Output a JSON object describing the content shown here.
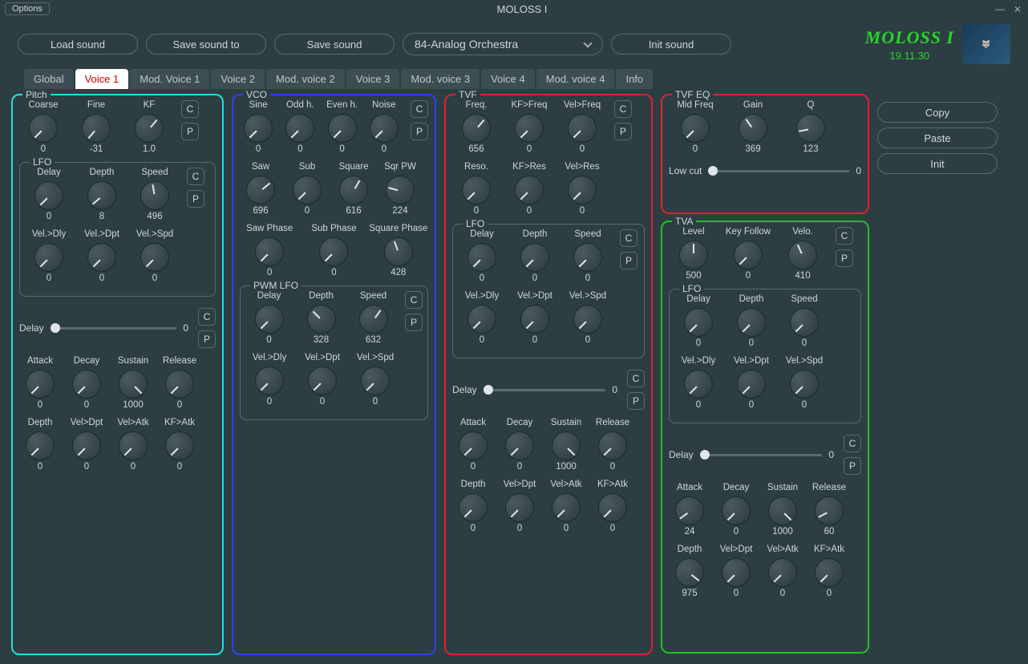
{
  "window": {
    "options": "Options",
    "title": "MOLOSS I"
  },
  "brand": {
    "name": "MOLOSS I",
    "version": "19.11.30"
  },
  "toolbar": {
    "load": "Load sound",
    "saveTo": "Save sound to",
    "save": "Save sound",
    "preset": "84-Analog Orchestra",
    "init": "Init sound"
  },
  "side": {
    "copy": "Copy",
    "paste": "Paste",
    "init": "Init"
  },
  "cp": {
    "c": "C",
    "p": "P"
  },
  "tabs": [
    "Global",
    "Voice 1",
    "Mod. Voice 1",
    "Voice 2",
    "Mod. voice 2",
    "Voice 3",
    "Mod. voice 3",
    "Voice 4",
    "Mod. voice 4",
    "Info"
  ],
  "pitch": {
    "title": "Pitch",
    "main": [
      {
        "label": "Coarse",
        "val": "0",
        "a": -135
      },
      {
        "label": "Fine",
        "val": "-31",
        "a": -140
      },
      {
        "label": "KF",
        "val": "1.0",
        "a": 40
      }
    ],
    "lfoTitle": "LFO",
    "lfo1": [
      {
        "label": "Delay",
        "val": "0",
        "a": -135
      },
      {
        "label": "Depth",
        "val": "8",
        "a": -130
      },
      {
        "label": "Speed",
        "val": "496",
        "a": -10
      }
    ],
    "lfo2": [
      {
        "label": "Vel.>Dly",
        "val": "0",
        "a": -135
      },
      {
        "label": "Vel.>Dpt",
        "val": "0",
        "a": -135
      },
      {
        "label": "Vel.>Spd",
        "val": "0",
        "a": -135
      }
    ],
    "delayLabel": "Delay",
    "delayVal": "0",
    "adsr": [
      {
        "label": "Attack",
        "val": "0",
        "a": -135
      },
      {
        "label": "Decay",
        "val": "0",
        "a": -135
      },
      {
        "label": "Sustain",
        "val": "1000",
        "a": 135
      },
      {
        "label": "Release",
        "val": "0",
        "a": -135
      }
    ],
    "depth": [
      {
        "label": "Depth",
        "val": "0",
        "a": -135
      },
      {
        "label": "Vel>Dpt",
        "val": "0",
        "a": -135
      },
      {
        "label": "Vel>Atk",
        "val": "0",
        "a": -135
      },
      {
        "label": "KF>Atk",
        "val": "0",
        "a": -135
      }
    ]
  },
  "vco": {
    "title": "VCO",
    "r1": [
      {
        "label": "Sine",
        "val": "0",
        "a": -135
      },
      {
        "label": "Odd h.",
        "val": "0",
        "a": -135
      },
      {
        "label": "Even h.",
        "val": "0",
        "a": -135
      },
      {
        "label": "Noise",
        "val": "0",
        "a": -135
      }
    ],
    "r2": [
      {
        "label": "Saw",
        "val": "696",
        "a": 50
      },
      {
        "label": "Sub",
        "val": "0",
        "a": -135
      },
      {
        "label": "Square",
        "val": "616",
        "a": 30
      },
      {
        "label": "Sqr PW",
        "val": "224",
        "a": -75
      }
    ],
    "r3": [
      {
        "label": "Saw Phase",
        "val": "0",
        "a": -135
      },
      {
        "label": "Sub Phase",
        "val": "0",
        "a": -135
      },
      {
        "label": "Square Phase",
        "val": "428",
        "a": -20
      }
    ],
    "pwmTitle": "PWM LFO",
    "pwm1": [
      {
        "label": "Delay",
        "val": "0",
        "a": -135
      },
      {
        "label": "Depth",
        "val": "328",
        "a": -45
      },
      {
        "label": "Speed",
        "val": "632",
        "a": 35
      }
    ],
    "pwm2": [
      {
        "label": "Vel.>Dly",
        "val": "0",
        "a": -135
      },
      {
        "label": "Vel.>Dpt",
        "val": "0",
        "a": -135
      },
      {
        "label": "Vel.>Spd",
        "val": "0",
        "a": -135
      }
    ]
  },
  "tvf": {
    "title": "TVF",
    "r1": [
      {
        "label": "Freq.",
        "val": "656",
        "a": 40
      },
      {
        "label": "KF>Freq",
        "val": "0",
        "a": -135
      },
      {
        "label": "Vel>Freq",
        "val": "0",
        "a": -135
      }
    ],
    "r2": [
      {
        "label": "Reso.",
        "val": "0",
        "a": -135
      },
      {
        "label": "KF>Res",
        "val": "0",
        "a": -135
      },
      {
        "label": "Vel>Res",
        "val": "0",
        "a": -135
      }
    ],
    "lfoTitle": "LFO",
    "lfo1": [
      {
        "label": "Delay",
        "val": "0",
        "a": -135
      },
      {
        "label": "Depth",
        "val": "0",
        "a": -135
      },
      {
        "label": "Speed",
        "val": "0",
        "a": -135
      }
    ],
    "lfo2": [
      {
        "label": "Vel.>Dly",
        "val": "0",
        "a": -135
      },
      {
        "label": "Vel.>Dpt",
        "val": "0",
        "a": -135
      },
      {
        "label": "Vel.>Spd",
        "val": "0",
        "a": -135
      }
    ],
    "delayLabel": "Delay",
    "delayVal": "0",
    "adsr": [
      {
        "label": "Attack",
        "val": "0",
        "a": -135
      },
      {
        "label": "Decay",
        "val": "0",
        "a": -135
      },
      {
        "label": "Sustain",
        "val": "1000",
        "a": 135
      },
      {
        "label": "Release",
        "val": "0",
        "a": -135
      }
    ],
    "depth": [
      {
        "label": "Depth",
        "val": "0",
        "a": -135
      },
      {
        "label": "Vel>Dpt",
        "val": "0",
        "a": -135
      },
      {
        "label": "Vel>Atk",
        "val": "0",
        "a": -135
      },
      {
        "label": "KF>Atk",
        "val": "0",
        "a": -135
      }
    ]
  },
  "tvfeq": {
    "title": "TVF EQ",
    "r": [
      {
        "label": "Mid Freq",
        "val": "0",
        "a": -135
      },
      {
        "label": "Gain",
        "val": "369",
        "a": -35
      },
      {
        "label": "Q",
        "val": "123",
        "a": -100
      }
    ],
    "lowcutLabel": "Low cut",
    "lowcutVal": "0"
  },
  "tva": {
    "title": "TVA",
    "r1": [
      {
        "label": "Level",
        "val": "500",
        "a": 0
      },
      {
        "label": "Key Follow",
        "val": "0",
        "a": -135
      },
      {
        "label": "Velo.",
        "val": "410",
        "a": -24
      }
    ],
    "lfoTitle": "LFO",
    "lfo1": [
      {
        "label": "Delay",
        "val": "0",
        "a": -135
      },
      {
        "label": "Depth",
        "val": "0",
        "a": -135
      },
      {
        "label": "Speed",
        "val": "0",
        "a": -135
      }
    ],
    "lfo2": [
      {
        "label": "Vel.>Dly",
        "val": "0",
        "a": -135
      },
      {
        "label": "Vel.>Dpt",
        "val": "0",
        "a": -135
      },
      {
        "label": "Vel.>Spd",
        "val": "0",
        "a": -135
      }
    ],
    "delayLabel": "Delay",
    "delayVal": "0",
    "adsr": [
      {
        "label": "Attack",
        "val": "24",
        "a": -126
      },
      {
        "label": "Decay",
        "val": "0",
        "a": -135
      },
      {
        "label": "Sustain",
        "val": "1000",
        "a": 135
      },
      {
        "label": "Release",
        "val": "60",
        "a": -118
      }
    ],
    "depth": [
      {
        "label": "Depth",
        "val": "975",
        "a": 128
      },
      {
        "label": "Vel>Dpt",
        "val": "0",
        "a": -135
      },
      {
        "label": "Vel>Atk",
        "val": "0",
        "a": -135
      },
      {
        "label": "KF>Atk",
        "val": "0",
        "a": -135
      }
    ]
  }
}
